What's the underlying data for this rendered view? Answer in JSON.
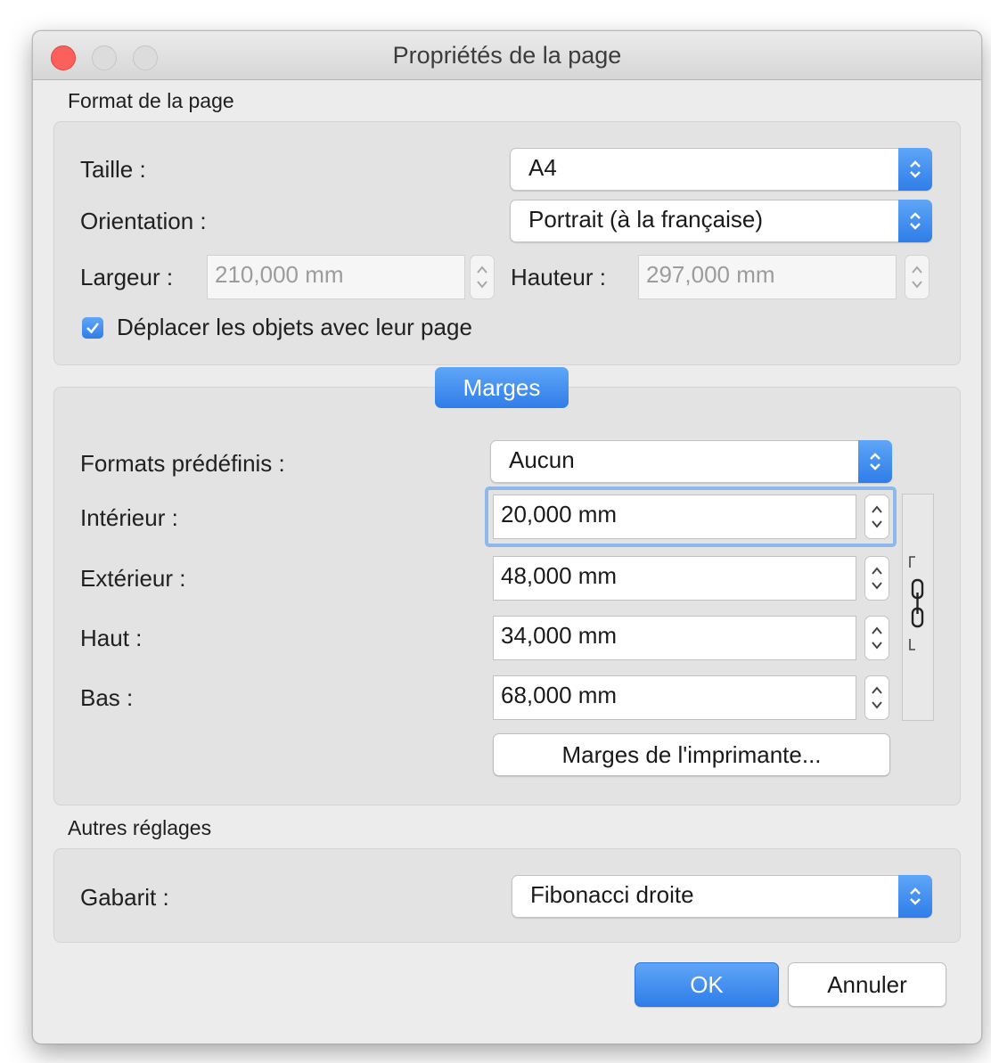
{
  "window": {
    "title": "Propriétés de la page"
  },
  "page_format": {
    "section_label": "Format de la page",
    "size_label": "Taille :",
    "size_value": "A4",
    "orientation_label": "Orientation :",
    "orientation_value": "Portrait (à la française)",
    "width_label": "Largeur :",
    "width_value": "210,000 mm",
    "height_label": "Hauteur :",
    "height_value": "297,000 mm",
    "move_objects_label": "Déplacer les objets avec leur page",
    "move_objects_checked": true
  },
  "margins": {
    "tab_label": "Marges",
    "presets_label": "Formats prédéfinis :",
    "presets_value": "Aucun",
    "inner_label": "Intérieur :",
    "inner_value": "20,000 mm",
    "outer_label": "Extérieur :",
    "outer_value": "48,000 mm",
    "top_label": "Haut :",
    "top_value": "34,000 mm",
    "bottom_label": "Bas :",
    "bottom_value": "68,000 mm",
    "printer_margins_button": "Marges de l'imprimante..."
  },
  "other": {
    "section_label": "Autres réglages",
    "template_label": "Gabarit :",
    "template_value": "Fibonacci droite"
  },
  "buttons": {
    "ok": "OK",
    "cancel": "Annuler"
  },
  "colors": {
    "accent": "#2f7de9",
    "close": "#fc605c"
  },
  "icons": {
    "popup": "updown-chevron-icon",
    "stepper": "stepper-icon",
    "link": "chain-link-icon",
    "check": "checkmark-icon"
  }
}
